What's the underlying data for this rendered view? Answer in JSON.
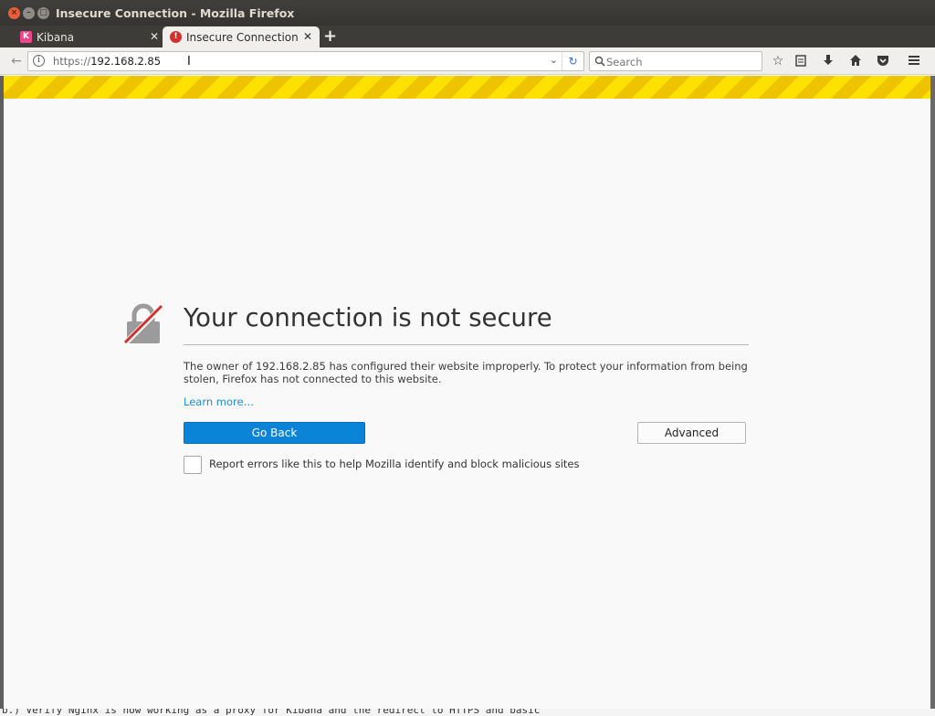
{
  "window": {
    "title": "Insecure Connection - Mozilla Firefox"
  },
  "tabs": [
    {
      "label": "Kibana",
      "favicon": "K"
    },
    {
      "label": "Insecure Connection",
      "favicon": "!"
    }
  ],
  "navbar": {
    "url_scheme": "https://",
    "url_host": "192.168.2.85",
    "search_placeholder": "Search"
  },
  "error_page": {
    "heading": "Your connection is not secure",
    "description": "The owner of 192.168.2.85 has configured their website improperly. To protect your information from being stolen, Firefox has not connected to this website.",
    "learn_more": "Learn more…",
    "go_back_label": "Go Back",
    "advanced_label": "Advanced",
    "report_label": "Report errors like this to help Mozilla identify and block malicious sites",
    "report_checked": false
  },
  "background_text": "b.) Verify Nginx is now working as a proxy for Kibana and the redirect to HTTPS and basic",
  "colors": {
    "primary_button": "#0a84d6",
    "warning_stripe": "#ffe100",
    "link": "#1d8fdb"
  }
}
